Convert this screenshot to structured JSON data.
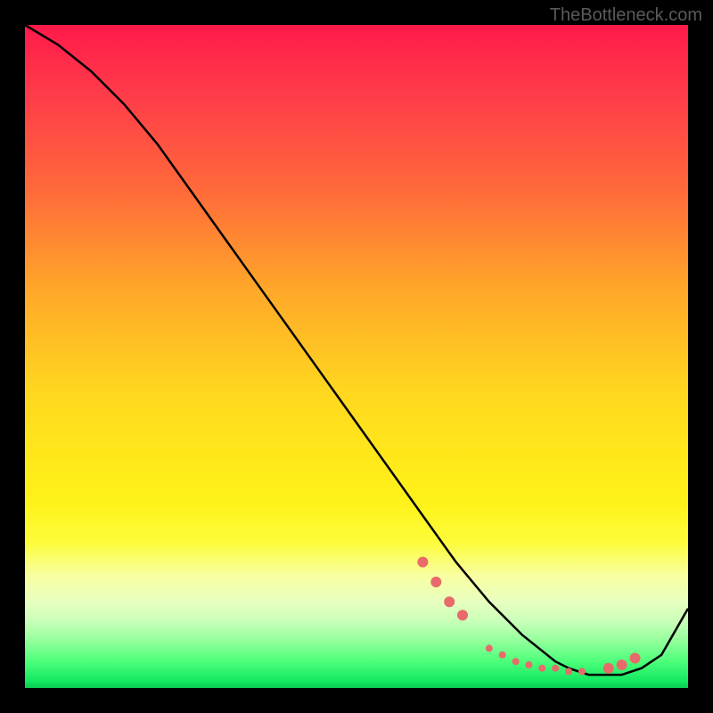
{
  "watermark": "TheBottleneck.com",
  "chart_data": {
    "type": "line",
    "title": "",
    "xlabel": "",
    "ylabel": "",
    "xlim": [
      0,
      100
    ],
    "ylim": [
      0,
      100
    ],
    "series": [
      {
        "name": "bottleneck-curve",
        "x": [
          0,
          5,
          10,
          15,
          20,
          25,
          30,
          35,
          40,
          45,
          50,
          55,
          60,
          65,
          70,
          75,
          80,
          82,
          85,
          88,
          90,
          93,
          96,
          100
        ],
        "y": [
          100,
          97,
          93,
          88,
          82,
          75,
          68,
          61,
          54,
          47,
          40,
          33,
          26,
          19,
          13,
          8,
          4,
          3,
          2,
          2,
          2,
          3,
          5,
          12
        ]
      }
    ],
    "markers": {
      "name": "highlight-points",
      "x": [
        60,
        62,
        64,
        66,
        70,
        72,
        74,
        76,
        78,
        80,
        82,
        84,
        88,
        90,
        92
      ],
      "y": [
        19,
        16,
        13,
        11,
        6,
        5,
        4,
        3.5,
        3,
        3,
        2.5,
        2.5,
        3,
        3.5,
        4.5
      ],
      "color": "#e86a6a",
      "radius_small": 4,
      "radius_large": 6
    },
    "gradient_stops": [
      {
        "pos": 0,
        "color": "#ff1a4a"
      },
      {
        "pos": 25,
        "color": "#ff6a3a"
      },
      {
        "pos": 55,
        "color": "#ffd61f"
      },
      {
        "pos": 78,
        "color": "#fdfc3a"
      },
      {
        "pos": 93,
        "color": "#90ff9a"
      },
      {
        "pos": 100,
        "color": "#0cc850"
      }
    ]
  }
}
